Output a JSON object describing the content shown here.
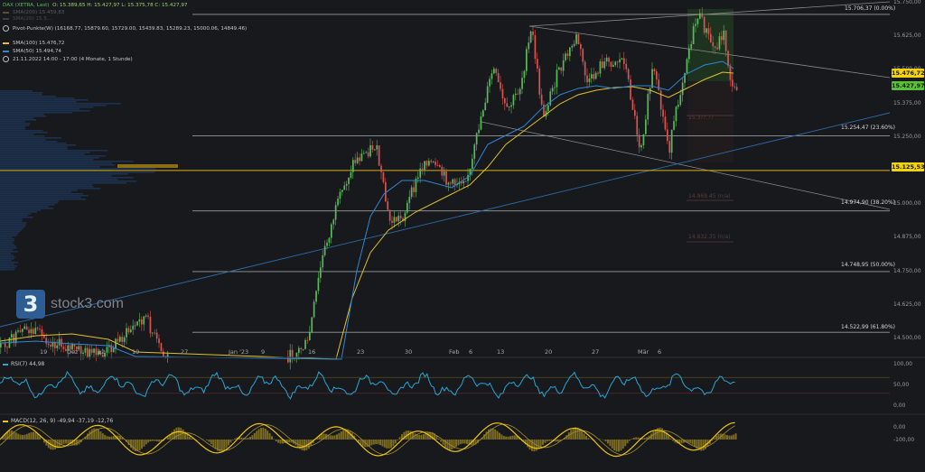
{
  "legend": {
    "instrument": "DAX (XETRA, Last)",
    "ohlc": "O: 15.389,65   H: 15.427,97   L: 15.375,78   C: 15.427,97",
    "sma200_faded": "SMA(200)   15.459,83",
    "sma20_faded": "SMA(20)   15.5...",
    "pivot": "Pivot-Punkte(W)   (16168.77,   15879.60,   15729.00,   15439.83,   15289.23,   15000.06,   14849.46)",
    "sma100": "SMA(100)   15.476,72",
    "sma50": "SMA(50)   15.494,74",
    "period": "21.11.2022 14:00 - 17:00   (4 Monate, 1 Stunde)"
  },
  "colors": {
    "background": "#17191d",
    "bull": "#5cb85c",
    "bear": "#d9534f",
    "sma_yellow": "#e0c12a",
    "sma_blue": "#2f86d4",
    "rsi": "#25a6d8",
    "macd_yellow": "#f1c40f",
    "hist": "#7a6a1f",
    "price_tag_yellow": "#f1d30f",
    "price_tag_green": "#5cbf3a"
  },
  "price_tags": {
    "yellow": "15.476,72",
    "green": "15.427,97",
    "hline": "15.125,53"
  },
  "fib_labels": [
    "15.706,37 (0.00%)",
    "15.254,47 (23.60%)",
    "14.974,90 (38.20%)",
    "14.748,95 (50.00%)",
    "14.522,99 (61.80%)"
  ],
  "fib_faded": [
    "15.3??.??",
    "14.969.45 (n/a)",
    "14.832.35 (n/a)"
  ],
  "logo": {
    "badge": "3",
    "name": "stock3.com"
  },
  "rsi_title": "RSI(7)   44,98",
  "macd_title": "MACD(12, 26, 9)   -49,94   -37,19   -12,76",
  "chart_data": {
    "type": "candlestick",
    "instrument": "DAX (XETRA, Last)",
    "interval": "1 Stunde",
    "ohlc_last": {
      "open": 15389.65,
      "high": 15427.97,
      "low": 15375.78,
      "close": 15427.97
    },
    "y_ticks": [
      "15.750,00",
      "15.625,00",
      "15.500,00",
      "15.375,00",
      "15.250,00",
      "15.125,00",
      "15.000,00",
      "14.875,00",
      "14.750,00",
      "14.625,00",
      "14.500,00"
    ],
    "ylim": [
      14470,
      15760
    ],
    "x_ticks": [
      "19",
      "Dez",
      "12",
      "19",
      "27",
      "Jan '23",
      "9",
      "16",
      "23",
      "30",
      "Feb",
      "6",
      "13",
      "20",
      "27",
      "Mär",
      "6"
    ],
    "series": [
      {
        "name": "SMA(100)",
        "last": 15476.72
      },
      {
        "name": "SMA(50)",
        "last": 15494.74
      }
    ],
    "fibonacci": [
      {
        "value": 15706.37,
        "level": "0.00%"
      },
      {
        "value": 15254.47,
        "level": "23.60%"
      },
      {
        "value": 14974.9,
        "level": "38.20%"
      },
      {
        "value": 14748.95,
        "level": "50.00%"
      },
      {
        "value": 14522.99,
        "level": "61.80%"
      }
    ],
    "horizontal_line": 15125.53,
    "rsi": {
      "name": "RSI(7)",
      "last": 44.98,
      "y_ticks": [
        "100,00",
        "50,00",
        "0,00"
      ]
    },
    "macd": {
      "name": "MACD(12, 26, 9)",
      "macd": -49.94,
      "signal": -37.19,
      "hist": -12.76,
      "y_ticks": [
        "0,00",
        "-100,00"
      ]
    },
    "grid": false
  }
}
